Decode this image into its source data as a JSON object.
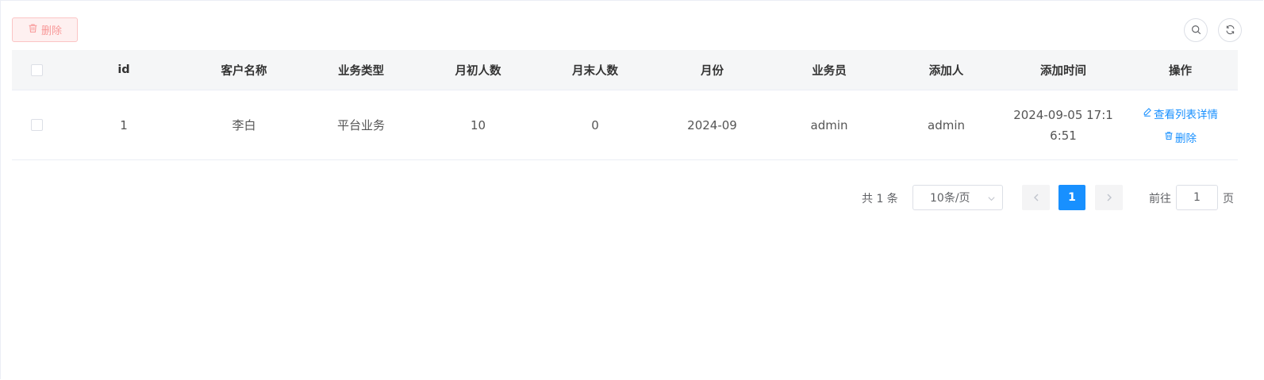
{
  "toolbar": {
    "delete_label": "删除"
  },
  "table": {
    "columns": [
      "id",
      "客户名称",
      "业务类型",
      "月初人数",
      "月末人数",
      "月份",
      "业务员",
      "添加人",
      "添加时间",
      "操作"
    ],
    "rows": [
      {
        "id": "1",
        "customer": "李白",
        "business_type": "平台业务",
        "start_count": "10",
        "end_count": "0",
        "month": "2024-09",
        "salesman": "admin",
        "added_by": "admin",
        "added_time": "2024-09-05 17:16:51",
        "actions": {
          "view": "查看列表详情",
          "delete": "删除"
        }
      }
    ]
  },
  "pagination": {
    "total_text": "共 1 条",
    "page_size": "10条/页",
    "current_page": "1",
    "jumper_prefix": "前往",
    "jumper_value": "1",
    "jumper_suffix": "页"
  },
  "colors": {
    "primary": "#1890ff",
    "danger_text": "#f89898",
    "danger_bg": "#fef0f0",
    "header_bg": "#f5f6f7"
  }
}
